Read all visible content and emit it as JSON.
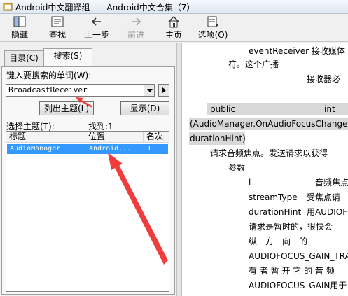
{
  "window": {
    "title": "Android中文翻译组——Android中文合集（7）"
  },
  "toolbar": {
    "hide": "隐藏",
    "find": "查找",
    "back": "上一步",
    "forward": "前进",
    "home": "主页",
    "options": "选项(O)"
  },
  "tabs": {
    "contents": "目录(C)",
    "search": "搜索(S)"
  },
  "search": {
    "prompt": "键入要搜索的单词(W):",
    "query": "BroadcastReceiver",
    "list_topics_button": "列出主题(L)",
    "display_button": "显示(D)",
    "select_topic_label": "选择主题(T):",
    "found_label": "找到:1"
  },
  "results": {
    "columns": [
      "标题",
      "位置",
      "名次"
    ],
    "rows": [
      {
        "title": "AudioManager",
        "location": "Android...",
        "rank": "1"
      }
    ]
  },
  "content": {
    "lines": [
      "eventReceiver 接收媒体",
      "符。这个广播",
      "接收器必",
      "public",
      "int",
      "(AudioManager.OnAudioFocusChangeLis",
      "durationHint)",
      "请求音频焦点。发送请求以获得",
      "参数",
      "l",
      "音频焦点",
      "streamType",
      "受焦点请",
      "durationHint",
      "用AUDIOF",
      "请求是暂时的，很快会",
      "纵　方　向　的",
      "AUDIOFOCUS_GAIN_TRA",
      "有 者 暂 开 它 的 音 频",
      "AUDIOFOCUS_GAIN用于"
    ]
  },
  "colors": {
    "selection": "#3399ff",
    "arrow": "#f03c3c"
  },
  "icons": [
    "app-icon",
    "hide-icon",
    "find-icon",
    "back-icon",
    "forward-icon",
    "home-icon",
    "options-icon",
    "annotation-arrow-icon"
  ]
}
